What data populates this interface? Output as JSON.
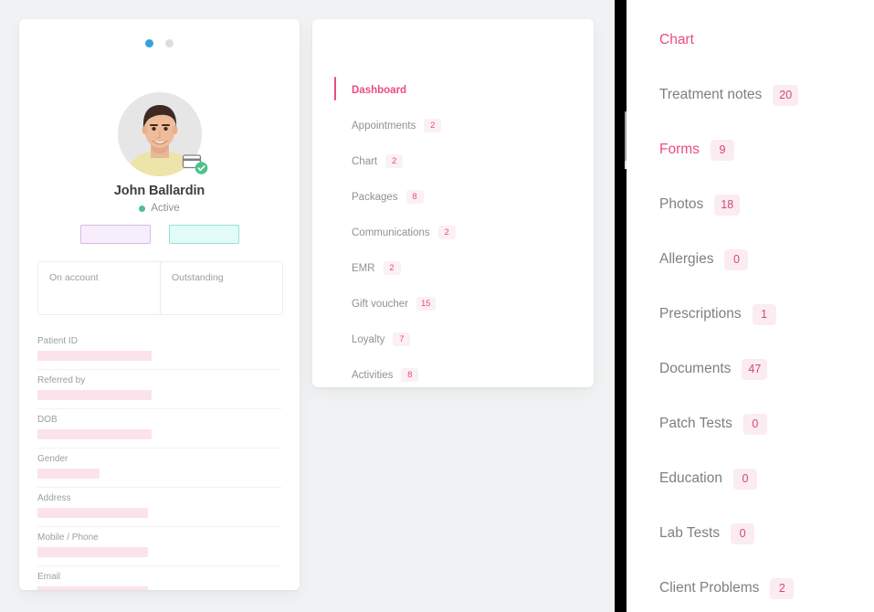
{
  "patient_card": {
    "pager": {
      "dots": [
        "active",
        "inactive"
      ]
    },
    "avatar": {
      "icon": "patient-photo",
      "badge_icon": "card-verified-badge"
    },
    "name": "John Ballardin",
    "status": "Active",
    "pills": [
      {
        "name": "lavender-action-pill",
        "label": ""
      },
      {
        "name": "cyan-action-pill",
        "label": ""
      }
    ],
    "account": [
      {
        "label": "On account",
        "value": ""
      },
      {
        "label": "Outstanding",
        "value": ""
      }
    ],
    "fields": [
      {
        "label": "Patient ID",
        "value": "",
        "redact_width": 125
      },
      {
        "label": "Referred by",
        "value": "",
        "redact_width": 125
      },
      {
        "label": "DOB",
        "value": "",
        "redact_width": 125
      },
      {
        "label": "Gender",
        "value": "",
        "redact_width": 68
      },
      {
        "label": "Address",
        "value": "",
        "redact_width": 121
      },
      {
        "label": "Mobile / Phone",
        "value": "",
        "redact_width": 121
      },
      {
        "label": "Email",
        "value": "",
        "redact_width": 121
      }
    ]
  },
  "menu_card": {
    "items": [
      {
        "label": "Dashboard",
        "count": "",
        "active": true
      },
      {
        "label": "Appointments",
        "count": "2",
        "active": false
      },
      {
        "label": "Chart",
        "count": "2",
        "active": false
      },
      {
        "label": "Packages",
        "count": "8",
        "active": false
      },
      {
        "label": "Communications",
        "count": "2",
        "active": false
      },
      {
        "label": "EMR",
        "count": "2",
        "active": false
      },
      {
        "label": "Gift voucher",
        "count": "15",
        "active": false
      },
      {
        "label": "Loyalty",
        "count": "7",
        "active": false
      },
      {
        "label": "Activities",
        "count": "8",
        "active": false
      }
    ]
  },
  "right_panel": {
    "items": [
      {
        "label": "Chart",
        "count": "",
        "active": true
      },
      {
        "label": "Treatment notes",
        "count": "20",
        "active": false
      },
      {
        "label": "Forms",
        "count": "9",
        "active": true
      },
      {
        "label": "Photos",
        "count": "18",
        "active": false
      },
      {
        "label": "Allergies",
        "count": "0",
        "active": false
      },
      {
        "label": "Prescriptions",
        "count": "1",
        "active": false
      },
      {
        "label": "Documents",
        "count": "47",
        "active": false
      },
      {
        "label": "Patch Tests",
        "count": "0",
        "active": false
      },
      {
        "label": "Education",
        "count": "0",
        "active": false
      },
      {
        "label": "Lab Tests",
        "count": "0",
        "active": false
      },
      {
        "label": "Client Problems",
        "count": "2",
        "active": false
      }
    ]
  },
  "colors": {
    "accent_pink": "#ea4c7f",
    "badge_bg": "#fbecf1",
    "status_green": "#4cc28a",
    "dot_blue": "#3aa0d8",
    "redact_pink": "#fbe3e9",
    "divider_black": "#000000",
    "scroll_thumb": "#e06a9c",
    "page_bg": "#f1f2f3"
  }
}
